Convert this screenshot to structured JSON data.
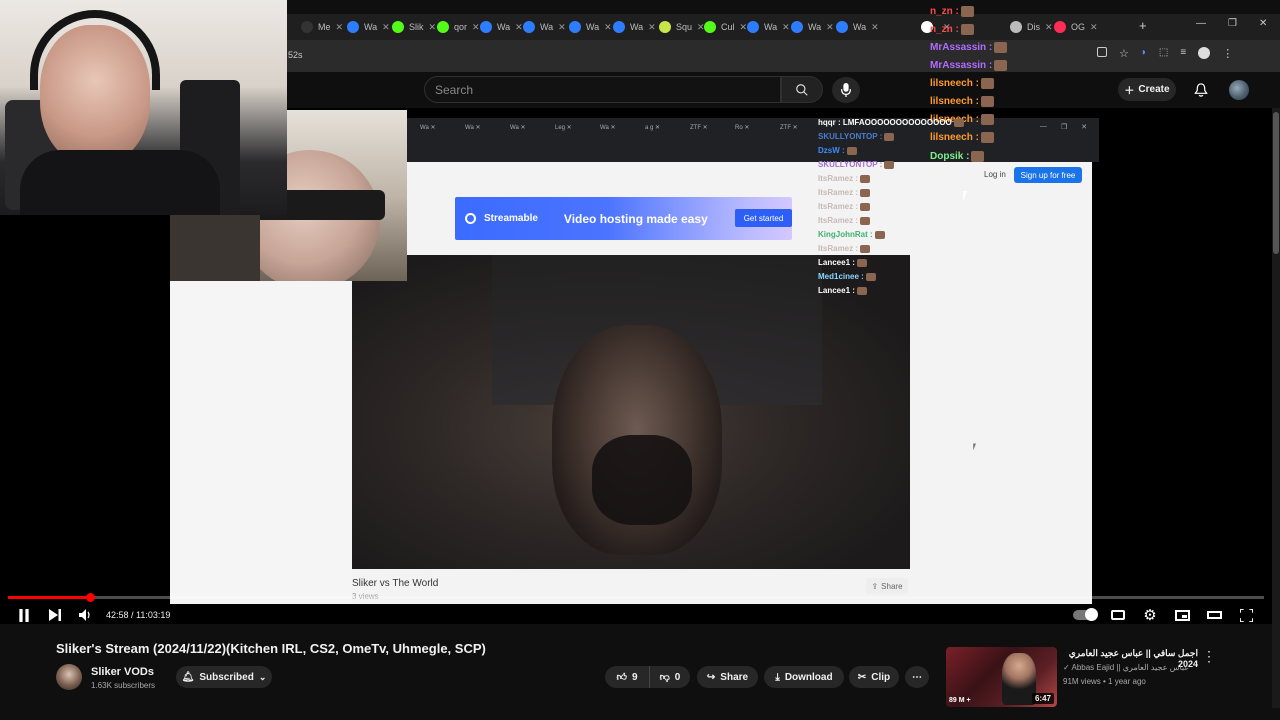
{
  "browser": {
    "tabs": [
      {
        "label": "Me",
        "icon": "app-s-icon",
        "color": "#333333"
      },
      {
        "label": "Wa",
        "icon": "streamable-icon",
        "color": "#2f7dff"
      },
      {
        "label": "Slik",
        "icon": "kick-icon",
        "color": "#53fc18"
      },
      {
        "label": "qor",
        "icon": "kick-icon",
        "color": "#53fc18"
      },
      {
        "label": "Wa",
        "icon": "streamable-icon",
        "color": "#2f7dff"
      },
      {
        "label": "Wa",
        "icon": "streamable-icon",
        "color": "#2f7dff"
      },
      {
        "label": "Wa",
        "icon": "streamable-icon",
        "color": "#2f7dff"
      },
      {
        "label": "Wa",
        "icon": "streamable-icon",
        "color": "#2f7dff"
      },
      {
        "label": "Squ",
        "icon": "squ-icon",
        "color": "#c7e44b"
      },
      {
        "label": "Cul",
        "icon": "kick-icon",
        "color": "#53fc18"
      },
      {
        "label": "Wa",
        "icon": "streamable-icon",
        "color": "#2f7dff"
      },
      {
        "label": "Wa",
        "icon": "streamable-icon",
        "color": "#2f7dff"
      },
      {
        "label": "Wa",
        "icon": "streamable-icon",
        "color": "#2f7dff"
      },
      {
        "label": "",
        "icon": "x-icon",
        "color": "#ffffff"
      },
      {
        "label": "Dis",
        "icon": "discord-icon",
        "color": "#bbbbbb"
      },
      {
        "label": "OG",
        "icon": "youtube-icon",
        "color": "#ff2d55"
      }
    ],
    "address_fragment": "52s",
    "window_controls": [
      "—",
      "❐",
      "✕"
    ]
  },
  "youtube": {
    "search_placeholder": "Search",
    "create_label": "Create"
  },
  "inner_page": {
    "banner_brand": "Streamable",
    "banner_text": "Video hosting made easy",
    "banner_button": "Get started",
    "login": "Log in",
    "signup": "Sign up for free",
    "video_title": "Sliker vs The World",
    "video_views": "3 views",
    "share": "Share",
    "inner_tabs": [
      "Wa",
      "Wa",
      "Wa",
      "Leg",
      "Wa",
      "a g",
      "ZTF",
      "Ro",
      "ZTF"
    ]
  },
  "chat": [
    {
      "user": "n_zn",
      "color": "#ff4b4b",
      "size": "big"
    },
    {
      "user": "n_zn",
      "color": "#ff4b4b",
      "size": "big"
    },
    {
      "user": "MrAssassin",
      "color": "#b26cff",
      "size": "big"
    },
    {
      "user": "MrAssassin",
      "color": "#b26cff",
      "size": "big"
    },
    {
      "user": "lilsneech",
      "color": "#ff9a2e",
      "size": "big"
    },
    {
      "user": "lilsneech",
      "color": "#ff9a2e",
      "size": "big"
    },
    {
      "user": "lilsneech",
      "color": "#ff9a2e",
      "size": "big"
    },
    {
      "user": "lilsneech",
      "color": "#ff9a2e",
      "size": "big"
    },
    {
      "user": "Dopsik",
      "color": "#7df08a",
      "size": "big"
    }
  ],
  "chat_small": [
    {
      "user": "hqqr",
      "msg": "LMFAOOOOOOOOOOOOOO",
      "color": "#ffffff"
    },
    {
      "user": "SKULLYONTOP",
      "msg": "",
      "color": "#4a7bd1"
    },
    {
      "user": "DzsW",
      "msg": "",
      "color": "#3c8cff"
    },
    {
      "user": "SKULLYONTOP",
      "msg": "",
      "color": "#a070d0"
    },
    {
      "user": "ItsRamez",
      "msg": "",
      "color": "#c8b8b8"
    },
    {
      "user": "ItsRamez",
      "msg": "",
      "color": "#c8b8b8"
    },
    {
      "user": "ItsRamez",
      "msg": "",
      "color": "#c8b8b8"
    },
    {
      "user": "ItsRamez",
      "msg": "",
      "color": "#c8b8b8"
    },
    {
      "user": "KingJohnRat",
      "msg": "",
      "color": "#3cb371"
    },
    {
      "user": "ItsRamez",
      "msg": "",
      "color": "#c8b8b8"
    },
    {
      "user": "Lancee1",
      "msg": "",
      "color": "#ffffff"
    },
    {
      "user": "Med1cinee",
      "msg": "",
      "color": "#8ad8ff"
    },
    {
      "user": "Lancee1",
      "msg": "",
      "color": "#ffffff"
    }
  ],
  "player": {
    "time_current": "42:58",
    "time_total": "11:03:19",
    "progress": 0.065
  },
  "video": {
    "title": "Sliker's Stream (2024/11/22)(Kitchen IRL, CS2, OmeTv, Uhmegle, SCP)",
    "channel": "Sliker VODs",
    "subscribers": "1.63K subscribers",
    "subscribed_label": "Subscribed",
    "likes": "9",
    "dislikes": "0",
    "share_label": "Share",
    "download_label": "Download",
    "clip_label": "Clip"
  },
  "recommended": {
    "title": "اجمل سافي || عباس عجيد العامري 2024",
    "channel": "Abbas Eajid || عباس عجيد العامري",
    "views": "91M views",
    "age": "1 year ago",
    "duration": "6:47",
    "thumb_badge": "89 M +"
  }
}
